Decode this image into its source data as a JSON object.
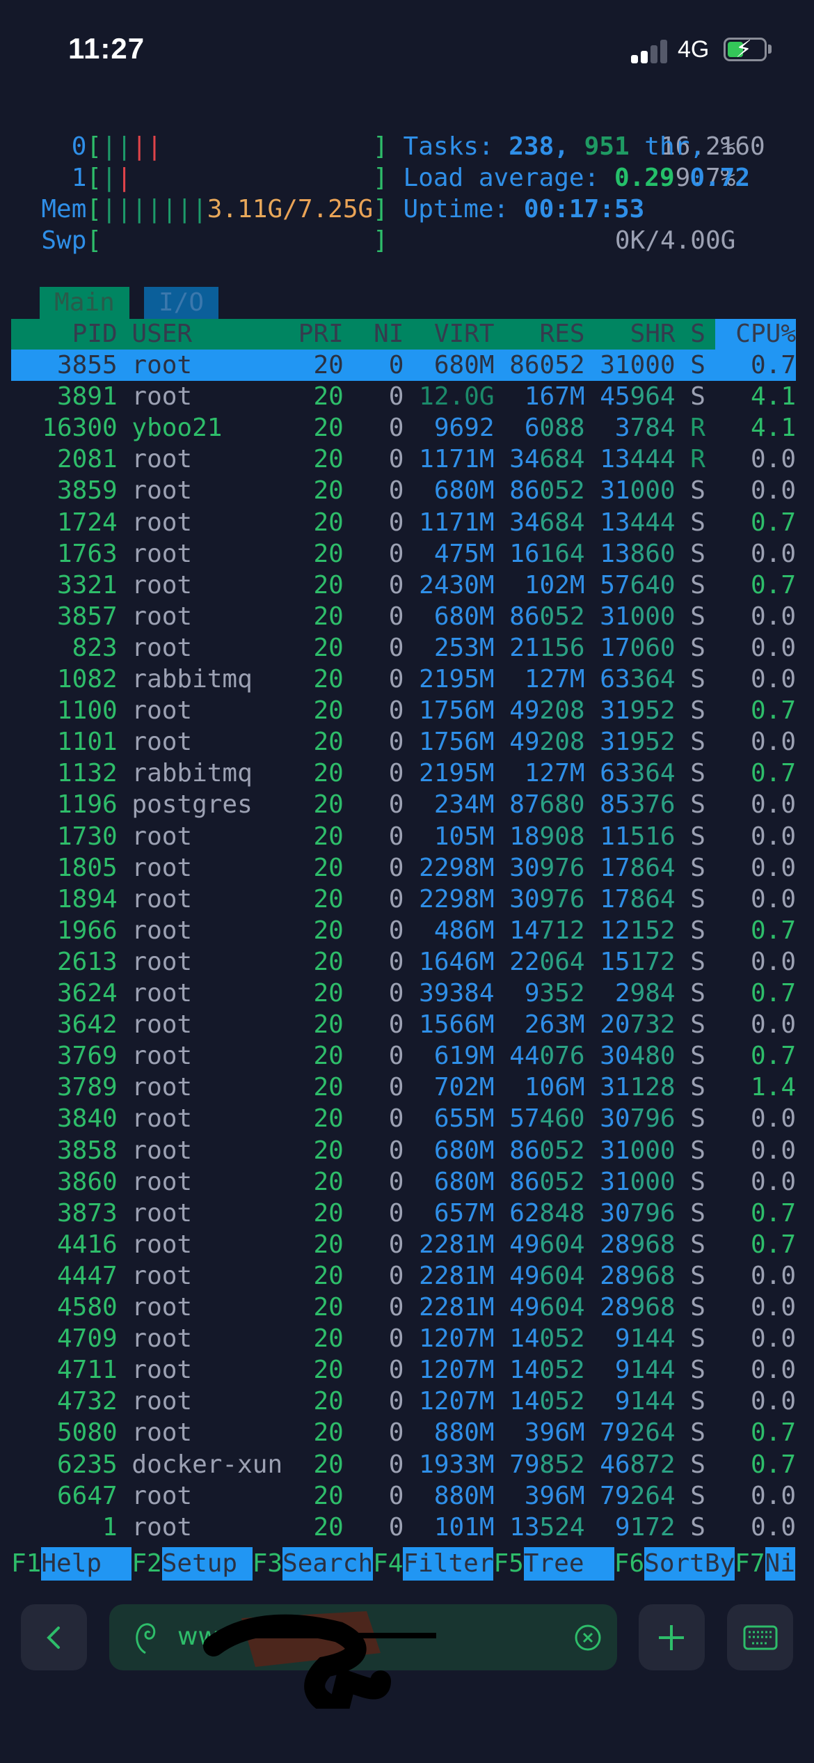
{
  "status_bar": {
    "time": "11:27",
    "network": "4G",
    "signal_bars": 2,
    "battery_level": 0.35,
    "charging": true
  },
  "meters": {
    "cpu0": {
      "label": "0",
      "value": "16.2%",
      "bars": [
        "green",
        "green",
        "red",
        "red"
      ]
    },
    "cpu1": {
      "label": "1",
      "value": "9.7%",
      "bars": [
        "green",
        "red"
      ]
    },
    "mem": {
      "label": "Mem",
      "used": "3.11G",
      "total": "7.25G",
      "value": "3.11G/7.25G"
    },
    "swp": {
      "label": "Swp",
      "value": "0K/4.00G"
    },
    "tasks": {
      "label": "Tasks:",
      "tasks": "238,",
      "threads": "951",
      "thr_label": "thr,",
      "running": "160"
    },
    "load": {
      "label": "Load average:",
      "one": "0.29",
      "five": "0.72"
    },
    "uptime": {
      "label": "Uptime:",
      "value": "00:17:53"
    }
  },
  "tabs": [
    {
      "label": "Main",
      "active": true
    },
    {
      "label": "I/O",
      "active": false
    }
  ],
  "columns": [
    "PID",
    "USER",
    "PRI",
    "NI",
    "VIRT",
    "RES",
    "SHR",
    "S",
    "CPU%"
  ],
  "rows": [
    {
      "pid": "3855",
      "user": "root",
      "pri": "20",
      "ni": "0",
      "virt": "680M",
      "res": "86052",
      "shr": "31000",
      "s": "S",
      "cpu": "0.7",
      "selected": true
    },
    {
      "pid": "3891",
      "user": "root",
      "pri": "20",
      "ni": "0",
      "virt": "12.0G",
      "res": "167M",
      "shr": "45964",
      "s": "S",
      "cpu": "4.1"
    },
    {
      "pid": "16300",
      "user": "yboo21",
      "pri": "20",
      "ni": "0",
      "virt": "9692",
      "res": "6088",
      "shr": "3784",
      "s": "R",
      "cpu": "4.1"
    },
    {
      "pid": "2081",
      "user": "root",
      "pri": "20",
      "ni": "0",
      "virt": "1171M",
      "res": "34684",
      "shr": "13444",
      "s": "R",
      "cpu": "0.0"
    },
    {
      "pid": "3859",
      "user": "root",
      "pri": "20",
      "ni": "0",
      "virt": "680M",
      "res": "86052",
      "shr": "31000",
      "s": "S",
      "cpu": "0.0"
    },
    {
      "pid": "1724",
      "user": "root",
      "pri": "20",
      "ni": "0",
      "virt": "1171M",
      "res": "34684",
      "shr": "13444",
      "s": "S",
      "cpu": "0.7"
    },
    {
      "pid": "1763",
      "user": "root",
      "pri": "20",
      "ni": "0",
      "virt": "475M",
      "res": "16164",
      "shr": "13860",
      "s": "S",
      "cpu": "0.0"
    },
    {
      "pid": "3321",
      "user": "root",
      "pri": "20",
      "ni": "0",
      "virt": "2430M",
      "res": "102M",
      "shr": "57640",
      "s": "S",
      "cpu": "0.7"
    },
    {
      "pid": "3857",
      "user": "root",
      "pri": "20",
      "ni": "0",
      "virt": "680M",
      "res": "86052",
      "shr": "31000",
      "s": "S",
      "cpu": "0.0"
    },
    {
      "pid": "823",
      "user": "root",
      "pri": "20",
      "ni": "0",
      "virt": "253M",
      "res": "21156",
      "shr": "17060",
      "s": "S",
      "cpu": "0.0"
    },
    {
      "pid": "1082",
      "user": "rabbitmq",
      "pri": "20",
      "ni": "0",
      "virt": "2195M",
      "res": "127M",
      "shr": "63364",
      "s": "S",
      "cpu": "0.0"
    },
    {
      "pid": "1100",
      "user": "root",
      "pri": "20",
      "ni": "0",
      "virt": "1756M",
      "res": "49208",
      "shr": "31952",
      "s": "S",
      "cpu": "0.7"
    },
    {
      "pid": "1101",
      "user": "root",
      "pri": "20",
      "ni": "0",
      "virt": "1756M",
      "res": "49208",
      "shr": "31952",
      "s": "S",
      "cpu": "0.0"
    },
    {
      "pid": "1132",
      "user": "rabbitmq",
      "pri": "20",
      "ni": "0",
      "virt": "2195M",
      "res": "127M",
      "shr": "63364",
      "s": "S",
      "cpu": "0.7"
    },
    {
      "pid": "1196",
      "user": "postgres",
      "pri": "20",
      "ni": "0",
      "virt": "234M",
      "res": "87680",
      "shr": "85376",
      "s": "S",
      "cpu": "0.0"
    },
    {
      "pid": "1730",
      "user": "root",
      "pri": "20",
      "ni": "0",
      "virt": "105M",
      "res": "18908",
      "shr": "11516",
      "s": "S",
      "cpu": "0.0"
    },
    {
      "pid": "1805",
      "user": "root",
      "pri": "20",
      "ni": "0",
      "virt": "2298M",
      "res": "30976",
      "shr": "17864",
      "s": "S",
      "cpu": "0.0"
    },
    {
      "pid": "1894",
      "user": "root",
      "pri": "20",
      "ni": "0",
      "virt": "2298M",
      "res": "30976",
      "shr": "17864",
      "s": "S",
      "cpu": "0.0"
    },
    {
      "pid": "1966",
      "user": "root",
      "pri": "20",
      "ni": "0",
      "virt": "486M",
      "res": "14712",
      "shr": "12152",
      "s": "S",
      "cpu": "0.7"
    },
    {
      "pid": "2613",
      "user": "root",
      "pri": "20",
      "ni": "0",
      "virt": "1646M",
      "res": "22064",
      "shr": "15172",
      "s": "S",
      "cpu": "0.0"
    },
    {
      "pid": "3624",
      "user": "root",
      "pri": "20",
      "ni": "0",
      "virt": "39384",
      "res": "9352",
      "shr": "2984",
      "s": "S",
      "cpu": "0.7"
    },
    {
      "pid": "3642",
      "user": "root",
      "pri": "20",
      "ni": "0",
      "virt": "1566M",
      "res": "263M",
      "shr": "20732",
      "s": "S",
      "cpu": "0.0"
    },
    {
      "pid": "3769",
      "user": "root",
      "pri": "20",
      "ni": "0",
      "virt": "619M",
      "res": "44076",
      "shr": "30480",
      "s": "S",
      "cpu": "0.7"
    },
    {
      "pid": "3789",
      "user": "root",
      "pri": "20",
      "ni": "0",
      "virt": "702M",
      "res": "106M",
      "shr": "31128",
      "s": "S",
      "cpu": "1.4"
    },
    {
      "pid": "3840",
      "user": "root",
      "pri": "20",
      "ni": "0",
      "virt": "655M",
      "res": "57460",
      "shr": "30796",
      "s": "S",
      "cpu": "0.0"
    },
    {
      "pid": "3858",
      "user": "root",
      "pri": "20",
      "ni": "0",
      "virt": "680M",
      "res": "86052",
      "shr": "31000",
      "s": "S",
      "cpu": "0.0"
    },
    {
      "pid": "3860",
      "user": "root",
      "pri": "20",
      "ni": "0",
      "virt": "680M",
      "res": "86052",
      "shr": "31000",
      "s": "S",
      "cpu": "0.0"
    },
    {
      "pid": "3873",
      "user": "root",
      "pri": "20",
      "ni": "0",
      "virt": "657M",
      "res": "62848",
      "shr": "30796",
      "s": "S",
      "cpu": "0.7"
    },
    {
      "pid": "4416",
      "user": "root",
      "pri": "20",
      "ni": "0",
      "virt": "2281M",
      "res": "49604",
      "shr": "28968",
      "s": "S",
      "cpu": "0.7"
    },
    {
      "pid": "4447",
      "user": "root",
      "pri": "20",
      "ni": "0",
      "virt": "2281M",
      "res": "49604",
      "shr": "28968",
      "s": "S",
      "cpu": "0.0"
    },
    {
      "pid": "4580",
      "user": "root",
      "pri": "20",
      "ni": "0",
      "virt": "2281M",
      "res": "49604",
      "shr": "28968",
      "s": "S",
      "cpu": "0.0"
    },
    {
      "pid": "4709",
      "user": "root",
      "pri": "20",
      "ni": "0",
      "virt": "1207M",
      "res": "14052",
      "shr": "9144",
      "s": "S",
      "cpu": "0.0"
    },
    {
      "pid": "4711",
      "user": "root",
      "pri": "20",
      "ni": "0",
      "virt": "1207M",
      "res": "14052",
      "shr": "9144",
      "s": "S",
      "cpu": "0.0"
    },
    {
      "pid": "4732",
      "user": "root",
      "pri": "20",
      "ni": "0",
      "virt": "1207M",
      "res": "14052",
      "shr": "9144",
      "s": "S",
      "cpu": "0.0"
    },
    {
      "pid": "5080",
      "user": "root",
      "pri": "20",
      "ni": "0",
      "virt": "880M",
      "res": "396M",
      "shr": "79264",
      "s": "S",
      "cpu": "0.7"
    },
    {
      "pid": "6235",
      "user": "docker-xun",
      "pri": "20",
      "ni": "0",
      "virt": "1933M",
      "res": "79852",
      "shr": "46872",
      "s": "S",
      "cpu": "0.7"
    },
    {
      "pid": "6647",
      "user": "root",
      "pri": "20",
      "ni": "0",
      "virt": "880M",
      "res": "396M",
      "shr": "79264",
      "s": "S",
      "cpu": "0.0"
    },
    {
      "pid": "1",
      "user": "root",
      "pri": "20",
      "ni": "0",
      "virt": "101M",
      "res": "13524",
      "shr": "9172",
      "s": "S",
      "cpu": "0.0"
    }
  ],
  "function_keys": [
    {
      "key": "F1",
      "label": "Help"
    },
    {
      "key": "F2",
      "label": "Setup"
    },
    {
      "key": "F3",
      "label": "Search"
    },
    {
      "key": "F4",
      "label": "Filter"
    },
    {
      "key": "F5",
      "label": "Tree"
    },
    {
      "key": "F6",
      "label": "SortBy"
    },
    {
      "key": "F7",
      "label": "Ni"
    }
  ],
  "toolbar": {
    "url_text": "www",
    "back": "back",
    "add": "new-session",
    "keyboard": "keyboard"
  },
  "colors": {
    "background": "#141829",
    "header_green": "#008561",
    "selection_blue": "#2196f3",
    "accent_green": "#2ebd6a"
  }
}
